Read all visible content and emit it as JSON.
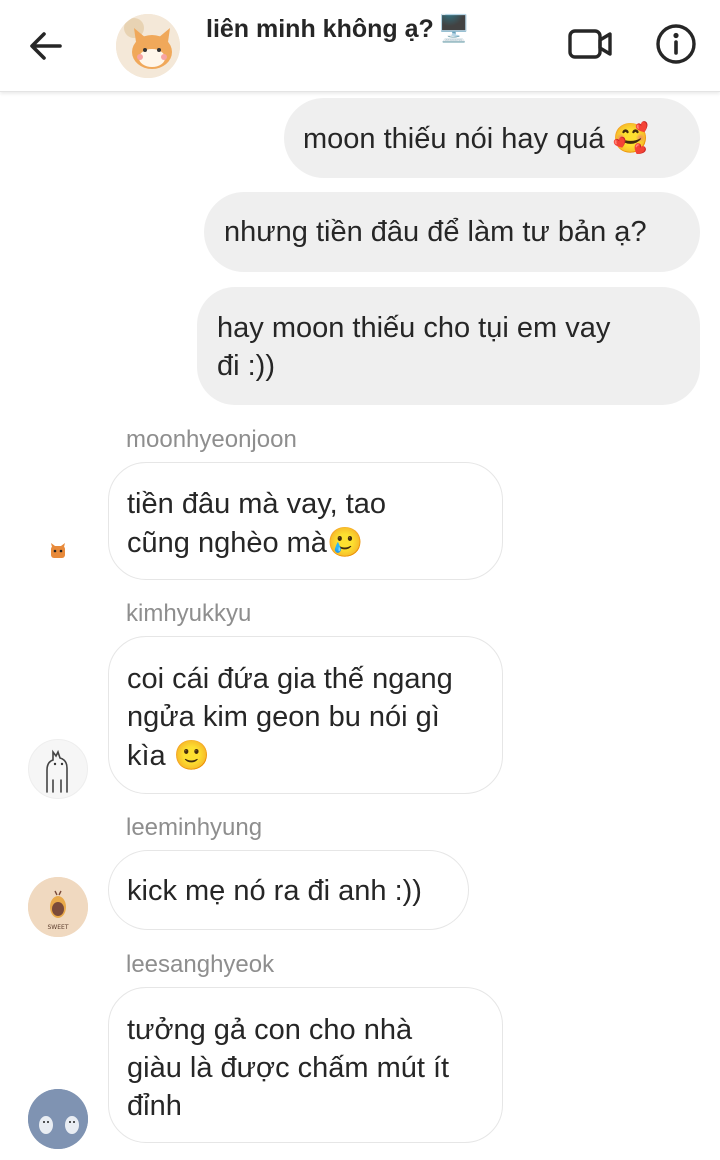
{
  "header": {
    "title": "liên minh không ạ?",
    "title_emoji": "🖥️",
    "back_icon": "arrow-left-icon",
    "video_icon": "video-camera-icon",
    "info_icon": "info-icon"
  },
  "outgoing": [
    {
      "text": "moon thiếu nói hay quá",
      "emoji": "🥰"
    },
    {
      "text": "nhưng tiền đâu để làm tư bản ạ?"
    },
    {
      "line1": "hay moon thiếu cho tụi em vay",
      "line2": "đi :))"
    }
  ],
  "messages": [
    {
      "sender": "moonhyeonjoon",
      "line1": "tiền đâu mà vay, tao",
      "line2": "cũng nghèo mà",
      "emoji": "🥲"
    },
    {
      "sender": "kimhyukkyu",
      "line1": "coi cái đứa gia thế ngang",
      "line2": "ngửa kim geon bu nói gì",
      "line3": "kìa",
      "emoji": "🙂"
    },
    {
      "sender": "leeminhyung",
      "line1": "kick mẹ nó ra đi anh :))"
    },
    {
      "sender": "leesanghyeok",
      "line1": "tưởng gả con cho nhà",
      "line2": "giàu là được chấm mút ít",
      "line3": "đỉnh"
    }
  ],
  "colors": {
    "outgoing_bubble": "#efefef",
    "incoming_border": "#e6e6e6",
    "sender_text": "#8e8e8e",
    "text": "#262626"
  }
}
